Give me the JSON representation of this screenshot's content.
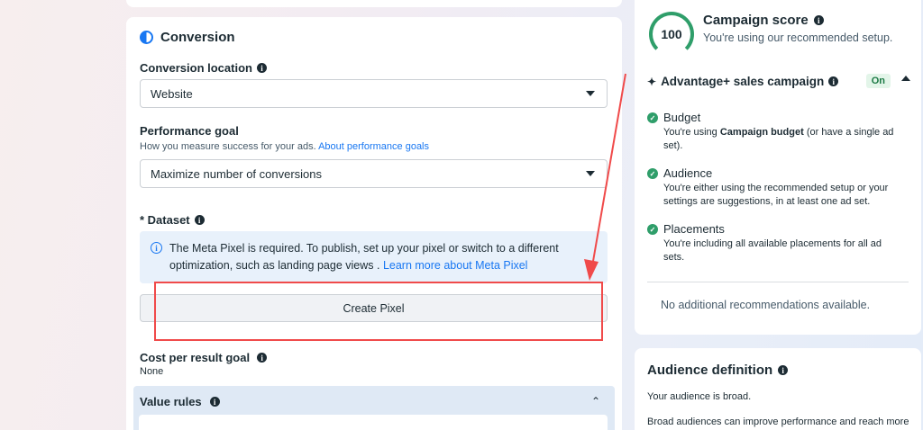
{
  "conversion": {
    "section_title": "Conversion",
    "location_label": "Conversion location",
    "location_value": "Website",
    "goal_label": "Performance goal",
    "goal_helper": "How you measure success for your ads.",
    "goal_helper_link": "About performance goals",
    "goal_value": "Maximize number of conversions",
    "dataset_label": "* Dataset",
    "notice_text": "The Meta Pixel is required. To publish, set up your pixel or switch to a different optimization, such as landing page views .",
    "notice_link": "Learn more about Meta Pixel",
    "create_pixel_label": "Create Pixel",
    "cost_goal_label": "Cost per result goal",
    "cost_goal_value": "None",
    "value_rules_label": "Value rules"
  },
  "score": {
    "value": "100",
    "title": "Campaign score",
    "subtitle": "You're using our recommended setup."
  },
  "advantage": {
    "title": "Advantage+ sales campaign",
    "status": "On"
  },
  "recommendations": [
    {
      "title": "Budget",
      "desc_prefix": "You're using",
      "desc_bold": "Campaign budget",
      "desc_suffix": "(or have a single ad set)."
    },
    {
      "title": "Audience",
      "desc": "You're either using the recommended setup or your settings are suggestions, in at least one ad set."
    },
    {
      "title": "Placements",
      "desc": "You're including all available placements for all ad sets."
    }
  ],
  "no_recommendations": "No additional recommendations available.",
  "audience": {
    "title": "Audience definition",
    "line1": "Your audience is broad.",
    "line2": "Broad audiences can improve performance and reach more"
  },
  "colors": {
    "accent": "#1877f2",
    "success": "#2f9e6a",
    "annotation_red": "#f04a4a"
  },
  "icons": [
    "half-circle-icon",
    "info-icon",
    "caret-down-icon",
    "sparkle-icon",
    "chevron-up-icon",
    "check-circle-icon"
  ]
}
